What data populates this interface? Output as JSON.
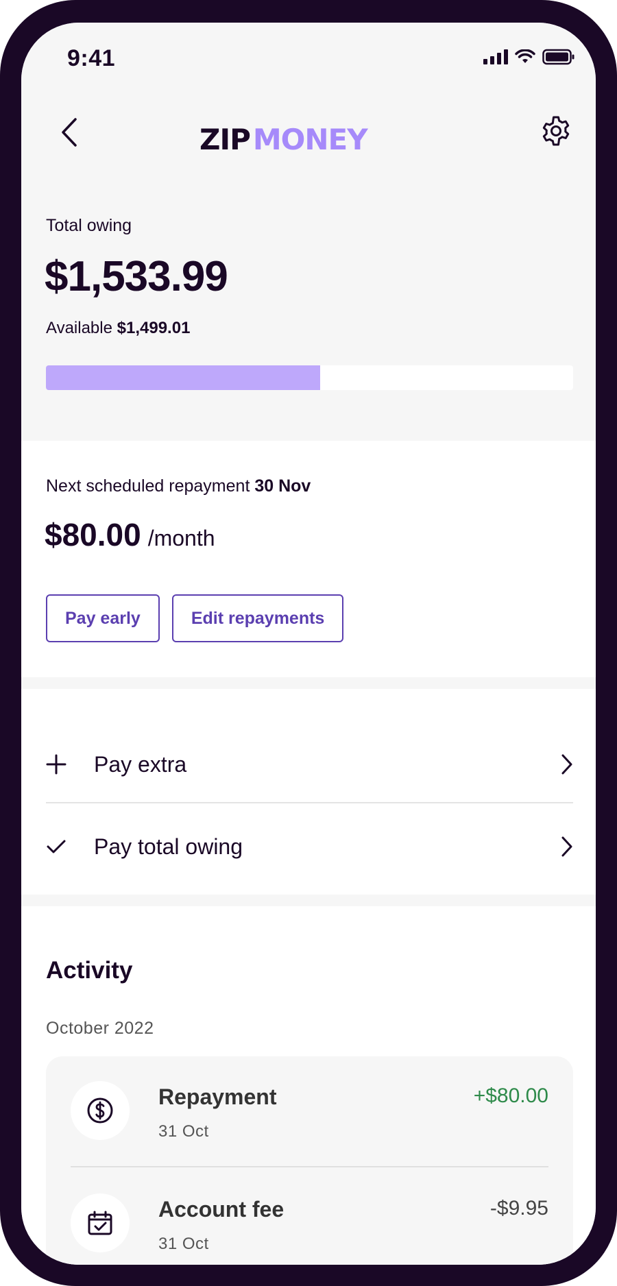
{
  "status_bar": {
    "time": "9:41",
    "icons": [
      "signal-icon",
      "wifi-icon",
      "battery-icon"
    ]
  },
  "header": {
    "logo_primary": "ZIP",
    "logo_secondary": "MONEY",
    "back_icon": "chevron-left-icon",
    "settings_icon": "gear-icon"
  },
  "balance": {
    "label": "Total owing",
    "amount": "$1,533.99",
    "available_prefix": "Available",
    "available_amount": "$1,499.01",
    "used_fraction": 0.52
  },
  "repayment": {
    "label": "Next scheduled repayment",
    "date": "30 Nov",
    "amount": "$80.00",
    "period": "/month",
    "pay_early_label": "Pay early",
    "edit_repayments_label": "Edit repayments"
  },
  "actions": [
    {
      "label": "Pay extra",
      "icon": "plus-icon"
    },
    {
      "label": "Pay total owing",
      "icon": "check-icon"
    }
  ],
  "activity": {
    "title": "Activity",
    "month": "October 2022",
    "items": [
      {
        "name": "Repayment",
        "date": "31 Oct",
        "amount": "+$80.00",
        "icon": "dollar-circle-icon"
      },
      {
        "name": "Account fee",
        "date": "31 Oct",
        "amount": "-$9.95",
        "icon": "calendar-check-icon"
      }
    ]
  },
  "colors": {
    "brand_dark": "#1a0826",
    "brand_purple": "#5b3fb0",
    "progress_fill": "#bea8fb",
    "positive": "#2e8a4a"
  }
}
